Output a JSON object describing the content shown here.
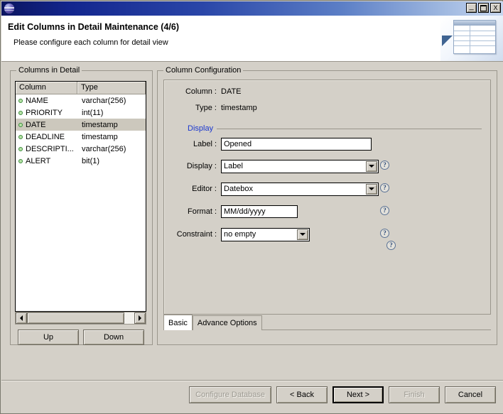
{
  "window": {
    "app_icon": "eclipse-sphere-icon",
    "title": "",
    "controls": {
      "minimize": "_",
      "maximize": "maximize-box",
      "close": "X"
    }
  },
  "header": {
    "title": "Edit Columns in Detail Maintenance (4/6)",
    "subtitle": "Please configure each column for detail view",
    "banner_icon": "table-detail-icon"
  },
  "columns_panel": {
    "legend": "Columns in Detail",
    "headers": [
      "Column",
      "Type"
    ],
    "rows": [
      {
        "bullet": "green-dot-icon",
        "column": "NAME",
        "type": "varchar(256)",
        "selected": false
      },
      {
        "bullet": "green-dot-icon",
        "column": "PRIORITY",
        "type": "int(11)",
        "selected": false
      },
      {
        "bullet": "green-dot-icon",
        "column": "DATE",
        "type": "timestamp",
        "selected": true
      },
      {
        "bullet": "green-dot-icon",
        "column": "DEADLINE",
        "type": "timestamp",
        "selected": false
      },
      {
        "bullet": "green-dot-icon",
        "column": "DESCRIPTI...",
        "type": "varchar(256)",
        "selected": false
      },
      {
        "bullet": "green-dot-icon",
        "column": "ALERT",
        "type": "bit(1)",
        "selected": false
      }
    ],
    "scrollbar": {
      "left_arrow": "arrow-left-icon",
      "right_arrow": "arrow-right-icon"
    },
    "up_label": "Up",
    "down_label": "Down"
  },
  "config_panel": {
    "legend": "Column Configuration",
    "column_label": "Column :",
    "column_value": "DATE",
    "type_label": "Type :",
    "type_value": "timestamp",
    "display_section": "Display",
    "fields": {
      "label_caption": "Label :",
      "label_value": "Opened",
      "display_caption": "Display :",
      "display_value": "Label",
      "editor_caption": "Editor :",
      "editor_value": "Datebox",
      "format_caption": "Format :",
      "format_value": "MM/dd/yyyy",
      "constraint_caption": "Constraint :",
      "constraint_value": "no empty"
    },
    "help_icon": "question-mark-icon",
    "help_glyph": "?",
    "tabs": [
      {
        "label": "Basic",
        "active": true
      },
      {
        "label": "Advance Options",
        "active": false
      }
    ]
  },
  "footer": {
    "buttons": [
      {
        "label": "Configure Database",
        "disabled": true,
        "default": false
      },
      {
        "label": "< Back",
        "disabled": false,
        "default": false
      },
      {
        "label": "Next >",
        "disabled": false,
        "default": true
      },
      {
        "label": "Finish",
        "disabled": true,
        "default": false
      },
      {
        "label": "Cancel",
        "disabled": false,
        "default": false
      }
    ]
  },
  "colors": {
    "chrome": "#d4d0c8",
    "title_start": "#0b1560",
    "title_end": "#c6d6ef",
    "accent_blue": "#1a37cf",
    "bullet_green": "#3d8b3d",
    "selection": "#ccc8bd"
  }
}
